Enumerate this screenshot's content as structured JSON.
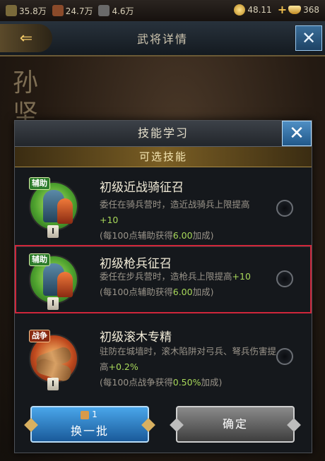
{
  "topbar": {
    "res1": "35.8万",
    "res2": "24.7万",
    "res3": "4.6万",
    "coins": "48.11",
    "ingots": "368",
    "plus": "+"
  },
  "header": {
    "back_glyph": "⇐",
    "title": "武将详情",
    "close_glyph": "✕"
  },
  "background": {
    "general_name": "孙 坚"
  },
  "modal": {
    "title": "技能学习",
    "close_glyph": "✕",
    "subheader": "可选技能",
    "skills": [
      {
        "tag": "辅助",
        "level": "I",
        "name": "初级近战骑征召",
        "desc_a": "委任在骑兵营时，造近战骑兵上限提高",
        "desc_hl": "+10",
        "note_a": "(每100点辅助获得",
        "note_val": "6.00",
        "note_b": "加成)"
      },
      {
        "tag": "辅助",
        "level": "I",
        "name": "初级枪兵征召",
        "desc_a": "委任在步兵营时，造枪兵上限提高",
        "desc_hl": "+10",
        "note_a": "(每100点辅助获得",
        "note_val": "6.00",
        "note_b": "加成)"
      },
      {
        "tag": "战争",
        "level": "I",
        "name": "初级滚木专精",
        "desc_a": "驻防在城墙时，滚木陷阱对弓兵、弩兵伤害提高",
        "desc_hl": "+0.2%",
        "note_a": "(每100点战争获得",
        "note_val": "0.50%",
        "note_b": "加成)"
      }
    ],
    "selected_index": 1,
    "refresh_count": "1",
    "refresh_label": "换一批",
    "confirm_label": "确定"
  },
  "colors": {
    "highlight": "#a8d85a",
    "selection_border": "#d0263a",
    "subheader_gold": "#7a5e24"
  }
}
